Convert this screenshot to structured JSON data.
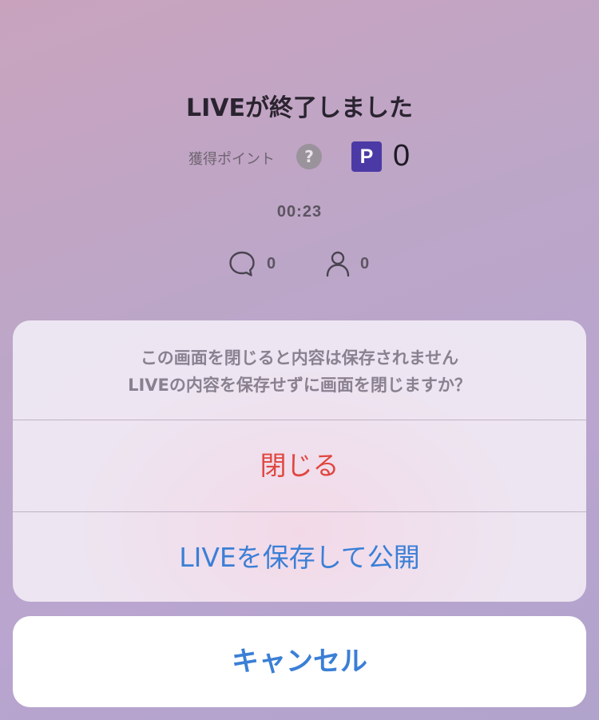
{
  "summary": {
    "title": "LIVEが終了しました",
    "points_label": "獲得ポイント",
    "help_symbol": "?",
    "points_badge": "P",
    "points_value": "0",
    "duration": "00:23",
    "comments_count": "0",
    "viewers_count": "0"
  },
  "icons": {
    "help": "question-circle-icon",
    "points": "points-badge-icon",
    "comments": "speech-bubble-icon",
    "viewers": "person-icon"
  },
  "action_sheet": {
    "message_line1": "この画面を閉じると内容は保存されません",
    "message_line2": "LIVEの内容を保存せずに画面を閉じますか？",
    "close_label": "閉じる",
    "publish_label": "LIVEを保存して公開",
    "cancel_label": "キャンセル"
  },
  "colors": {
    "destructive": "#e0473f",
    "action": "#3b7fd6",
    "badge": "#4b3aa6"
  }
}
